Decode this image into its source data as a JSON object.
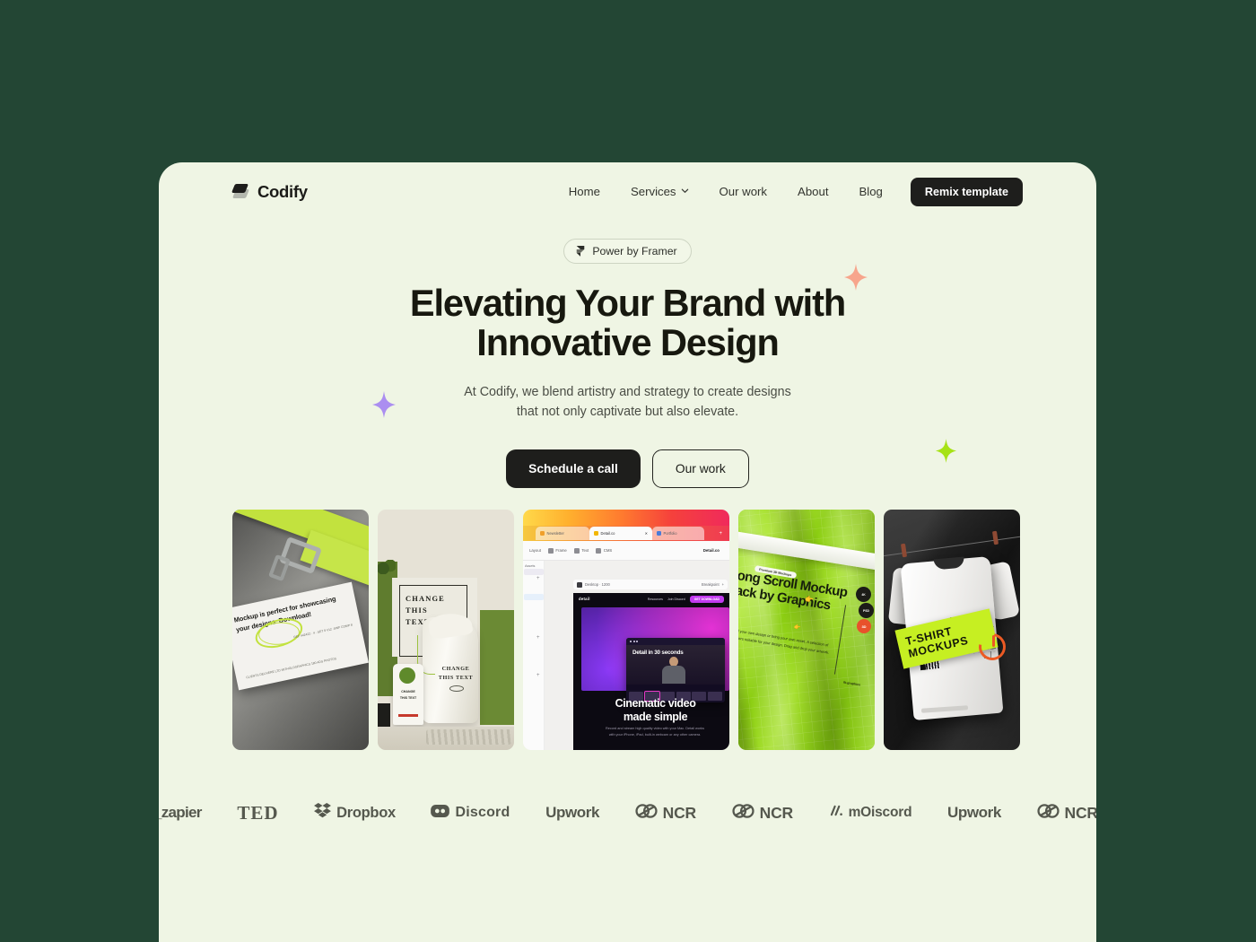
{
  "page": {
    "background_color": "#234634",
    "panel_color": "#eff5e4"
  },
  "nav": {
    "brand": "Codify",
    "brand_icon": "layers-icon",
    "links": [
      {
        "label": "Home",
        "icon": null
      },
      {
        "label": "Services",
        "icon": "chevron-down-icon"
      },
      {
        "label": "Our work",
        "icon": null
      },
      {
        "label": "About",
        "icon": null
      },
      {
        "label": "Blog",
        "icon": null
      }
    ],
    "cta": "Remix template"
  },
  "hero": {
    "badge": {
      "icon": "framer-icon",
      "label": "Power by Framer"
    },
    "headline_line1": "Elevating Your Brand with",
    "headline_line2": "Innovative Design",
    "subtitle_line1": "At Codify, we blend artistry and strategy to create designs",
    "subtitle_line2": "that not only captivate but also elevate.",
    "primary_cta": "Schedule a call",
    "secondary_cta": "Our work"
  },
  "decorations": [
    {
      "name": "sparkle-salmon",
      "color": "#f7a58c"
    },
    {
      "name": "sparkle-purple",
      "color": "#ab8ef0"
    },
    {
      "name": "sparkle-lime",
      "color": "#a6e215"
    }
  ],
  "gallery": [
    {
      "name": "mockup-business-card",
      "card_text": "Mockup is perfect for showcasing your designs. Download!",
      "fine_left": "CLIENTS DELIVERE LTD\nMITHOLOGRAPHICS\n180 ADS PHOTOS",
      "fine_right": "REF 442422 · 4 · SET 9\nV12 ·SWF COMP 8",
      "accent_color": "#c2e23e"
    },
    {
      "name": "mockup-tote-bag",
      "poster_text": "CHANGE\nTHIS\nTEXT",
      "bag_text": "CHANGE\nTHIS TEXT",
      "tag_text": "CHANGE\nTHIS TEXT",
      "accent_color": "#5f7c2e"
    },
    {
      "name": "framer-editor-screenshot",
      "tabs": [
        {
          "label": "Newsletter",
          "state": "inactive",
          "dot_color": "#f0a02a"
        },
        {
          "label": "Detail.co",
          "state": "active",
          "dot_color": "#f2b705"
        },
        {
          "label": "Portfolio",
          "state": "inactive",
          "dot_color": "#4a7bd8"
        }
      ],
      "new_tab_label": "+",
      "toolbar": [
        "Layout",
        "Frame",
        "Text",
        "CMS"
      ],
      "toolbar_right": "Detail.co",
      "sidebar_label": "Assets",
      "breakpoint_label": "Desktop · 1200",
      "breakpoint_right": "Breakpoint",
      "site_logo": "detail",
      "site_links": [
        "Resources",
        "Join Discord"
      ],
      "site_button": "GET DOWNLOAD",
      "video_title": "Detail in 30 seconds",
      "site_headline_line1": "Cinematic video",
      "site_headline_line2": "made simple",
      "site_paragraph": "Record and stream high quality video with your Mac. Detail works with your iPhone, iPad, built-in webcam or any other camera."
    },
    {
      "name": "mockup-green-fabric",
      "pill": "Premium 3D Mockups",
      "title": "Long Scroll Mockup Pack by Graphics",
      "body": "Add your own design or bring your own asset. A selection of renders suitable for your design. Drag and drop your artwork.",
      "badges": [
        "4K",
        "PSD",
        "3D"
      ],
      "credit": "ib.graphics",
      "accent_color": "#9ada1c"
    },
    {
      "name": "mockup-tshirt",
      "banner_line1": "T-SHIRT",
      "banner_line2": "MOCKUPS",
      "accent_color": "#c6ef22",
      "mark_color": "#ec5a24"
    }
  ],
  "logos": [
    {
      "name": "zapier",
      "label": "_zapier"
    },
    {
      "name": "ted",
      "label": "TED"
    },
    {
      "name": "dropbox",
      "label": "Dropbox"
    },
    {
      "name": "discord",
      "label": "Discord"
    },
    {
      "name": "upwork",
      "label": "Upwork"
    },
    {
      "name": "ncr",
      "label": "NCR"
    },
    {
      "name": "ncr-2",
      "label": "NCR"
    },
    {
      "name": "moiscord",
      "label": "mOiscord"
    },
    {
      "name": "upwork-2",
      "label": "Upwork"
    },
    {
      "name": "ncr-3",
      "label": "NCR"
    }
  ]
}
